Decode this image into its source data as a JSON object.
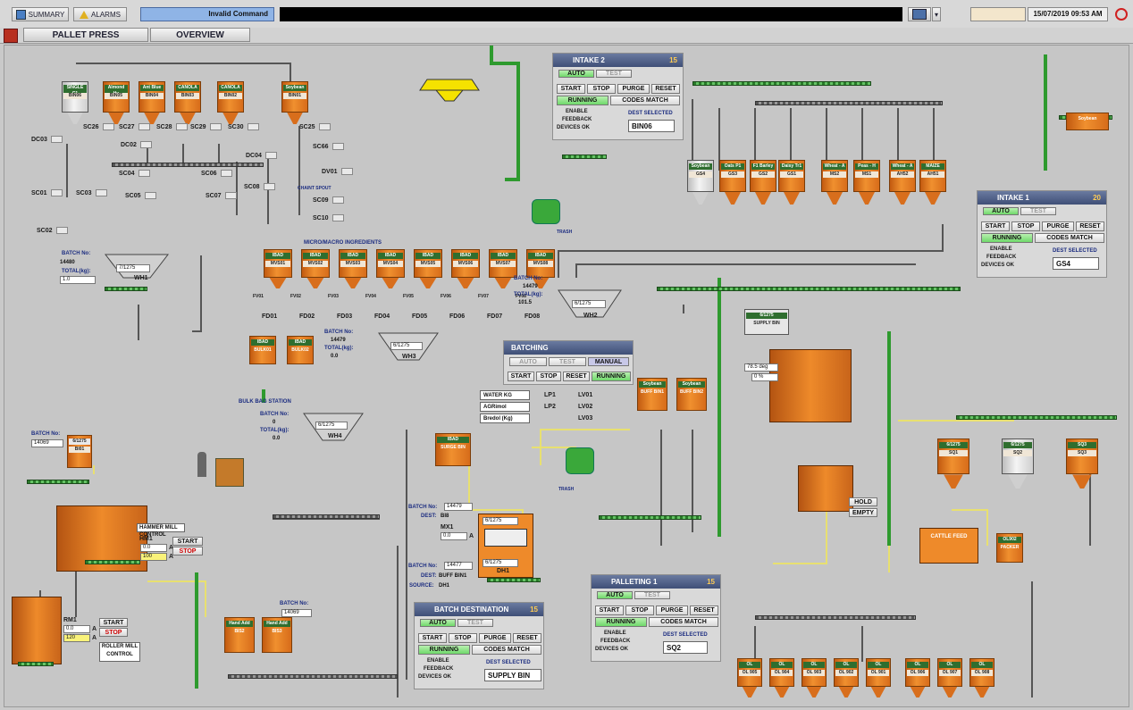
{
  "header": {
    "summary": "SUMMARY",
    "alarms": "ALARMS",
    "message": "Invalid Command",
    "date": "15/07/2019",
    "time": "09:53 AM"
  },
  "nav": {
    "tab1": "PALLET PRESS",
    "tab2": "OVERVIEW"
  },
  "colors": {
    "orange": "#e8801e",
    "green": "#3a9a3a",
    "panel_header": "#4a5a82"
  },
  "bins_top": [
    {
      "tag": "SINGLE C1",
      "name": "BIN06"
    },
    {
      "tag": "Almond Hu",
      "name": "BIN05"
    },
    {
      "tag": "Ant Blue",
      "name": "BIN04"
    },
    {
      "tag": "CANOLA",
      "name": "BIN03"
    },
    {
      "tag": "CANOLA",
      "name": "BIN02"
    },
    {
      "tag": "Soybean",
      "name": "BIN01"
    }
  ],
  "micro": {
    "title": "MICRO/MACRO INGREDIENTS",
    "bins": [
      "MVS01",
      "MVS02",
      "MVS03",
      "MVS04",
      "MVS05",
      "MVS06",
      "MVS07",
      "MVS08"
    ],
    "tag": "IBAD",
    "feeders": [
      "FD01",
      "FD02",
      "FD03",
      "FD04",
      "FD05",
      "FD06",
      "FD07",
      "FD08"
    ],
    "valves": [
      "FV01",
      "FV02",
      "FV03",
      "FV04",
      "FV05",
      "FV06",
      "FV07",
      "FV08"
    ]
  },
  "intake2": {
    "title": "INTAKE 2",
    "num": "15",
    "auto": "AUTO",
    "test": "TEST",
    "start": "START",
    "stop": "STOP",
    "purge": "PURGE",
    "reset": "RESET",
    "running": "RUNNING",
    "codes": "CODES MATCH",
    "enable": "ENABLE",
    "feedback": "FEEDBACK",
    "devices": "DEVICES OK",
    "dest_label": "DEST SELECTED",
    "dest": "BIN06"
  },
  "intake1": {
    "title": "INTAKE 1",
    "num": "20",
    "auto": "AUTO",
    "test": "TEST",
    "start": "START",
    "stop": "STOP",
    "purge": "PURGE",
    "reset": "RESET",
    "running": "RUNNING",
    "codes": "CODES MATCH",
    "enable": "ENABLE",
    "feedback": "FEEDBACK",
    "devices": "DEVICES OK",
    "dest_label": "DEST SELECTED",
    "dest": "GS4"
  },
  "batching": {
    "title": "BATCHING",
    "auto": "AUTO",
    "test": "TEST",
    "manual": "MANUAL",
    "start": "START",
    "stop": "STOP",
    "reset": "RESET",
    "running": "RUNNING",
    "rows": [
      {
        "name": "WATER KG",
        "pump": "LP1",
        "valve": "LV01"
      },
      {
        "name": "AGRimol",
        "pump": "LP2",
        "valve": "LV02"
      },
      {
        "name": "Bredol (Kg)",
        "pump": "",
        "valve": "LV03"
      }
    ]
  },
  "batchdest": {
    "title": "BATCH DESTINATION",
    "num": "15",
    "auto": "AUTO",
    "test": "TEST",
    "start": "START",
    "stop": "STOP",
    "purge": "PURGE",
    "reset": "RESET",
    "running": "RUNNING",
    "codes": "CODES MATCH",
    "enable": "ENABLE",
    "feedback": "FEEDBACK",
    "devices": "DEVICES OK",
    "dest_label": "DEST SELECTED",
    "dest": "SUPPLY BIN"
  },
  "palleting": {
    "title": "PALLETING 1",
    "num": "15",
    "auto": "AUTO",
    "test": "TEST",
    "start": "START",
    "stop": "STOP",
    "purge": "PURGE",
    "reset": "RESET",
    "running": "RUNNING",
    "codes": "CODES MATCH",
    "enable": "ENABLE",
    "feedback": "FEEDBACK",
    "devices": "DEVICES OK",
    "dest_label": "DEST SELECTED",
    "dest": "SQ2"
  },
  "wh1": {
    "batch_lbl": "BATCH No:",
    "batch": "14480",
    "total_lbl": "TOTAL(kg):",
    "total": "1.0",
    "id": "WH1",
    "code": "7/1275"
  },
  "wh2": {
    "batch_lbl": "BATCH No:",
    "batch": "14479",
    "total_lbl": "TOTAL(kg):",
    "total": "101.5",
    "id": "WH2",
    "code": "6/1275"
  },
  "wh3": {
    "batch_lbl": "BATCH No:",
    "batch": "14479",
    "total_lbl": "TOTAL(kg):",
    "total": "0.0",
    "id": "WH3",
    "code": "6/1275"
  },
  "wh4": {
    "batch_lbl": "BATCH No:",
    "batch": "0",
    "total_lbl": "TOTAL(kg):",
    "total": "0.0",
    "id": "WH4",
    "code": "6/1275"
  },
  "bi01": {
    "batch_lbl": "BATCH No:",
    "batch": "14069",
    "code": "6/1275",
    "name": "BI01"
  },
  "hammer": {
    "title": "HAMMER MILL CONTROL",
    "id": "HM1",
    "amps": "0.0",
    "amps2": "100",
    "unit": "A",
    "start": "START",
    "stop": "STOP"
  },
  "roller": {
    "id": "RM1",
    "amps": "0.0",
    "amps2": "120",
    "unit": "A",
    "start": "START",
    "stop": "STOP",
    "title1": "ROLLER MILL",
    "title2": "CONTROL"
  },
  "mixer": {
    "batch_lbl": "BATCH No:",
    "batch": "14479",
    "dest_lbl": "DEST:",
    "dest": "BI8",
    "mx": "MX1",
    "mx_amps": "0.0",
    "unit": "A",
    "code": "6/1275"
  },
  "dh1": {
    "batch_lbl": "BATCH No:",
    "batch": "14477",
    "dest_lbl": "DEST:",
    "dest": "BUFF BIN1",
    "src_lbl": "SOURCE:",
    "src": "DH1",
    "code": "6/1275",
    "id": "DH1"
  },
  "surge": {
    "tag": "IBAD",
    "name": "SURGE BIN"
  },
  "pellet": {
    "deg": "78.5 deg",
    "pct": "0 %",
    "supply1": "6/1275",
    "supply": "SUPPLY BIN",
    "supply2": "6/1275",
    "hold": "HOLD",
    "empty": "EMPTY"
  },
  "bb02": {
    "batch_lbl": "BATCH No:",
    "batch": "14069"
  },
  "grain_bins": [
    {
      "tag": "Soybean",
      "name": "GS4"
    },
    {
      "tag": "Oats P1",
      "name": "GS3"
    },
    {
      "tag": "F1 Barley",
      "name": "GS2"
    },
    {
      "tag": "Daisy Tr1",
      "name": "GS1"
    },
    {
      "tag": "Wheat - A",
      "name": "MS2"
    },
    {
      "tag": "Peas - H",
      "name": "MS1"
    },
    {
      "tag": "Wheat - A",
      "name": "AH52"
    },
    {
      "tag": "MAIZE",
      "name": "AH51"
    }
  ],
  "sq_bins": [
    {
      "tag": "6/1275",
      "name": "SQ1"
    },
    {
      "tag": "6/1275",
      "name": "SQ2"
    },
    {
      "tag": "SQ3",
      "name": "SQ3"
    }
  ],
  "ol_bins": [
    "OL 905",
    "OL 904",
    "OL 903",
    "OL 902",
    "OL 901"
  ],
  "ol_bins2": [
    "OL 906",
    "OL 907",
    "OL 908"
  ],
  "bulk": {
    "b1": "BULK01",
    "b2": "BULK02",
    "tag": "IBAD",
    "station": "BULK BAG STATION"
  },
  "buff": {
    "b1": "BUFF BIN1",
    "b2": "BUFF BIN2",
    "tag": "Soybean"
  },
  "bins_b": {
    "b2": "BIS2",
    "b3": "BIS3",
    "tag": "Hand Add"
  },
  "misc": {
    "chaint": "CHAINT SPOUT",
    "trash": "TRASH",
    "cattle": "CATTLE FEED",
    "packer": "PACKER",
    "ol_tag": "OL902",
    "bulkbag": "BULK BAG",
    "sb01": "Soybean"
  },
  "labels": [
    {
      "t": "SC26",
      "k": "a"
    },
    {
      "t": "SC27",
      "k": "a"
    },
    {
      "t": "SC28",
      "k": "a"
    },
    {
      "t": "SC29",
      "k": "a"
    },
    {
      "t": "SC30",
      "k": "a"
    },
    {
      "t": "SC25",
      "k": "a"
    },
    {
      "t": "DC03",
      "k": "a"
    },
    {
      "t": "DC02",
      "k": "a"
    },
    {
      "t": "DC04",
      "k": "a"
    },
    {
      "t": "SC66",
      "k": "a"
    },
    {
      "t": "DV01",
      "k": "a"
    },
    {
      "t": "SC04",
      "k": "a"
    },
    {
      "t": "SC06",
      "k": "a"
    },
    {
      "t": "SC05",
      "k": "a"
    },
    {
      "t": "SC07",
      "k": "a"
    },
    {
      "t": "SC08",
      "k": "a"
    },
    {
      "t": "SC01",
      "k": "a"
    },
    {
      "t": "SC03",
      "k": "a"
    },
    {
      "t": "SC09",
      "k": "a"
    },
    {
      "t": "SC10",
      "k": "a"
    },
    {
      "t": "SC02",
      "k": "a"
    }
  ]
}
